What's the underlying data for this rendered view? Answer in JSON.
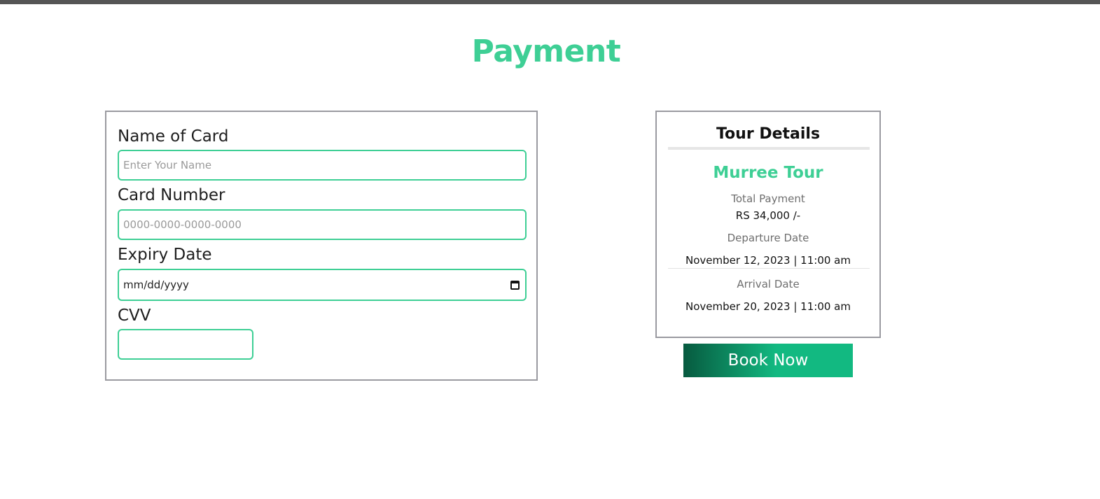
{
  "page": {
    "title": "Payment"
  },
  "form": {
    "name_label": "Name of Card",
    "name_placeholder": "Enter Your Name",
    "card_label": "Card Number",
    "card_placeholder": "0000-0000-0000-0000",
    "expiry_label": "Expiry Date",
    "expiry_placeholder": "mm/dd/yyyy",
    "cvv_label": "CVV",
    "cvv_value": ""
  },
  "details": {
    "title": "Tour Details",
    "tour_name": "Murree Tour",
    "total_label": "Total Payment",
    "total_value": "RS 34,000 /-",
    "departure_label": "Departure Date",
    "departure_value": "November 12, 2023 | 11:00 am",
    "arrival_label": "Arrival Date",
    "arrival_value": "November 20, 2023 | 11:00 am"
  },
  "actions": {
    "book_label": "Book Now"
  },
  "colors": {
    "accent": "#3ecf95",
    "button_start": "#075a3f",
    "button_end": "#12b981",
    "card_border": "#9a9aa0"
  },
  "icons": {
    "calendar": "calendar-icon"
  }
}
